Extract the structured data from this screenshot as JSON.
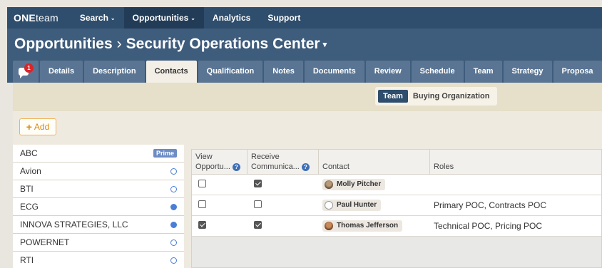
{
  "nav": {
    "logo_bold": "ONE",
    "logo_rest": "team",
    "items": [
      {
        "label": "Search",
        "caret": "⌄"
      },
      {
        "label": "Opportunities",
        "caret": "⌄"
      },
      {
        "label": "Analytics",
        "caret": ""
      },
      {
        "label": "Support",
        "caret": ""
      }
    ]
  },
  "title": {
    "parent": "Opportunities",
    "separator": "›",
    "current": "Security Operations Center"
  },
  "tabs": {
    "chat_badge": "1",
    "items": [
      "Details",
      "Description",
      "Contacts",
      "Qualification",
      "Notes",
      "Documents",
      "Review",
      "Schedule",
      "Team",
      "Strategy",
      "Proposa"
    ],
    "active": "Contacts"
  },
  "segmented": {
    "team": "Team",
    "buying": "Buying Organization"
  },
  "add_button": "Add",
  "orgs": [
    {
      "name": "ABC",
      "marker": "prime",
      "prime_label": "Prime"
    },
    {
      "name": "Avion",
      "marker": "empty"
    },
    {
      "name": "BTI",
      "marker": "empty"
    },
    {
      "name": "ECG",
      "marker": "full"
    },
    {
      "name": "INNOVA STRATEGIES, LLC",
      "marker": "full"
    },
    {
      "name": "POWERNET",
      "marker": "empty"
    },
    {
      "name": "RTI",
      "marker": "empty"
    }
  ],
  "table": {
    "headers": {
      "view_line1": "View",
      "view_line2": "Opportu...",
      "receive_line1": "Receive",
      "receive_line2": "Communica...",
      "contact": "Contact",
      "roles": "Roles"
    },
    "rows": [
      {
        "view": false,
        "receive": true,
        "contact": "Molly Pitcher",
        "roles": ""
      },
      {
        "view": false,
        "receive": false,
        "contact": "Paul Hunter",
        "roles": "Primary POC, Contracts POC"
      },
      {
        "view": true,
        "receive": true,
        "contact": "Thomas Jefferson",
        "roles": "Technical POC, Pricing POC"
      }
    ]
  },
  "colors": {
    "nav_bg": "#2f4d6c",
    "title_bg": "#3e5c7c",
    "accent": "#4a7dd6",
    "add_orange": "#d88a13"
  }
}
